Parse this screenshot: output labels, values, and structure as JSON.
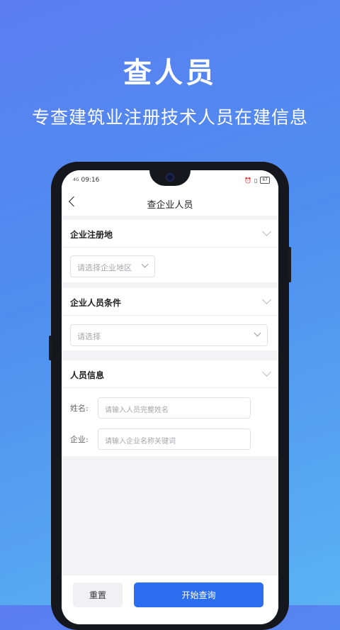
{
  "hero": {
    "title": "查人员",
    "subtitle": "专查建筑业注册技术人员在建信息"
  },
  "status_bar": {
    "signal": "4G",
    "time": "09:16",
    "battery": "67"
  },
  "navbar": {
    "title": "查企业人员"
  },
  "section_region": {
    "title": "企业注册地",
    "select_placeholder": "请选择企业地区"
  },
  "section_conditions": {
    "title": "企业人员条件",
    "select_placeholder": "请选择"
  },
  "section_person": {
    "title": "人员信息",
    "name_label": "姓名:",
    "name_placeholder": "请输入人员完整姓名",
    "company_label": "企业:",
    "company_placeholder": "请输入企业名称关键词"
  },
  "actions": {
    "reset_label": "重置",
    "search_label": "开始查询"
  },
  "colors": {
    "primary": "#2b6ff0",
    "background_top": "#5a7df0",
    "background_bottom": "#5bb2f2"
  }
}
